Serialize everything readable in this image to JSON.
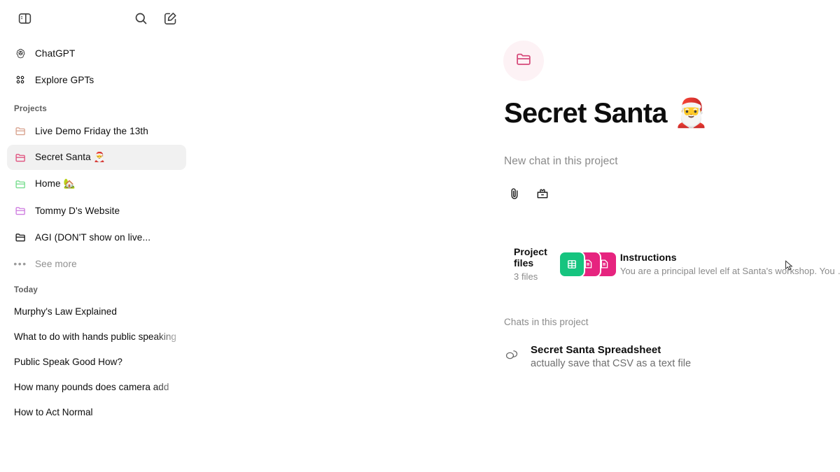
{
  "app": {
    "name": "ChatGPT"
  },
  "sidebar": {
    "top_actions": [
      {
        "name": "toggle-sidebar",
        "icon": "sidebar-toggle-icon"
      },
      {
        "name": "search-chats",
        "icon": "search-icon"
      },
      {
        "name": "new-chat",
        "icon": "new-chat-icon"
      }
    ],
    "primary_items": [
      {
        "label": "ChatGPT",
        "icon": "openai-logo-icon"
      },
      {
        "label": "Explore GPTs",
        "icon": "grid-dots-icon"
      }
    ],
    "projects_heading": "Projects",
    "projects": [
      {
        "label": "Live Demo Friday the 13th",
        "icon": "folder-icon",
        "color": "#d9a490",
        "active": false
      },
      {
        "label": "Secret Santa 🎅",
        "icon": "folder-icon",
        "color": "#e0527f",
        "active": true
      },
      {
        "label": "Home 🏡",
        "icon": "folder-icon",
        "color": "#77dd8e",
        "active": false
      },
      {
        "label": "Tommy D's Website",
        "icon": "folder-icon",
        "color": "#cf7ee0",
        "active": false
      },
      {
        "label": "AGI (DON'T show on live...",
        "icon": "folder-icon",
        "color": "#1a1a1a",
        "active": false
      }
    ],
    "see_more_label": "See more",
    "see_more_icon": "ellipsis-icon",
    "today_heading": "Today",
    "today_chats": [
      {
        "label": "Murphy's Law Explained"
      },
      {
        "label": "What to do with hands public speaking"
      },
      {
        "label": "Public Speak Good How?"
      },
      {
        "label": "How many pounds does camera add"
      },
      {
        "label": "How to Act Normal"
      }
    ]
  },
  "project": {
    "badge_icon": "folder-icon",
    "badge_color": "#d64a7a",
    "badge_bg": "#fdf2f5",
    "title": "Secret Santa",
    "title_emoji": "🎅",
    "composer_placeholder": "New chat in this project",
    "composer_tools": [
      {
        "name": "attach-file",
        "icon": "paperclip-icon"
      },
      {
        "name": "project-tools",
        "icon": "toolbox-icon"
      }
    ],
    "send_button_icon": "arrow-up-icon",
    "files_card": {
      "title": "Project files",
      "subtitle": "3 files",
      "file_chips": [
        {
          "icon": "spreadsheet-icon",
          "color": "#16c47f"
        },
        {
          "icon": "document-icon",
          "color": "#e6247f"
        },
        {
          "icon": "document-icon",
          "color": "#e6247f"
        }
      ]
    },
    "instructions_card": {
      "title": "Instructions",
      "subtitle": "You are a principal level elf at Santa's workshop. You …"
    },
    "chats_heading": "Chats in this project",
    "chats": [
      {
        "icon": "chat-bubbles-icon",
        "title": "Secret Santa Spreadsheet",
        "subtitle": "actually save that CSV as a text file"
      }
    ]
  }
}
